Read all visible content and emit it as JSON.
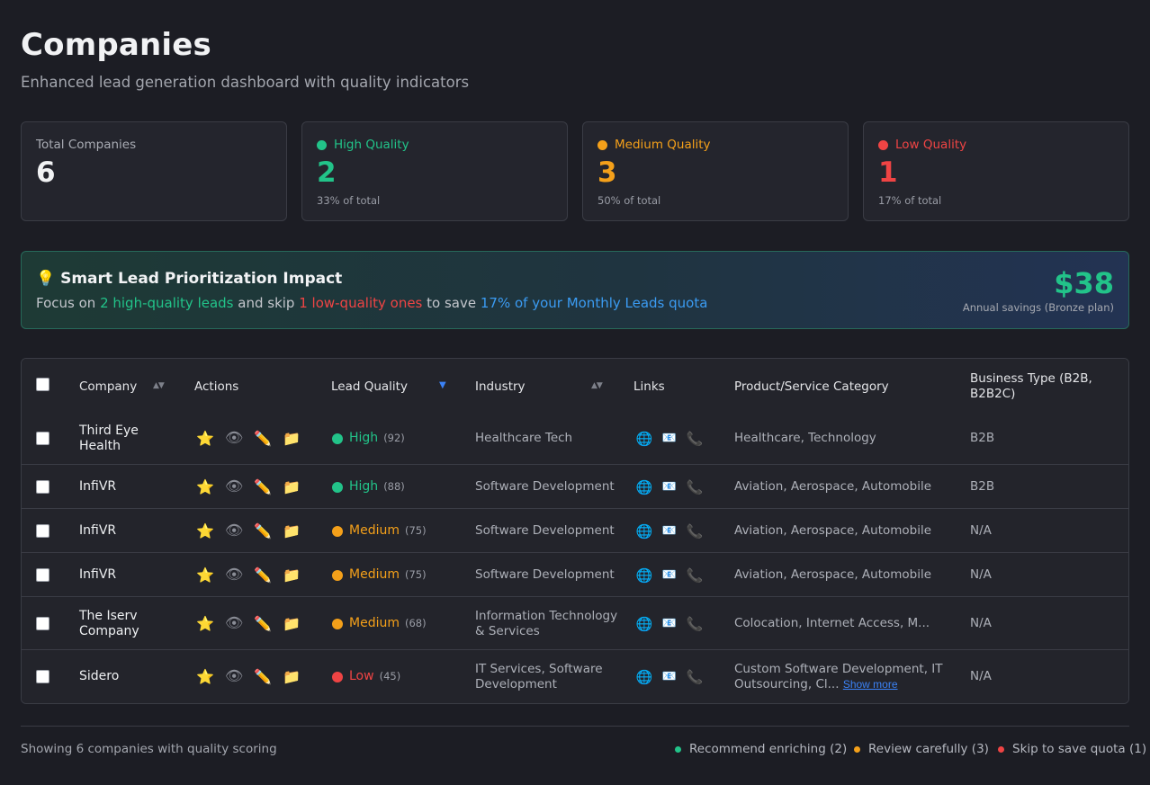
{
  "header": {
    "title": "Companies",
    "subtitle": "Enhanced lead generation dashboard with quality indicators"
  },
  "stats": {
    "total": {
      "label": "Total Companies",
      "value": "6"
    },
    "high": {
      "label": "High Quality",
      "value": "2",
      "sub": "33% of total",
      "color": "#22c389"
    },
    "medium": {
      "label": "Medium Quality",
      "value": "3",
      "sub": "50% of total",
      "color": "#f4a01a"
    },
    "low": {
      "label": "Low Quality",
      "value": "1",
      "sub": "17% of total",
      "color": "#ef4444"
    }
  },
  "banner": {
    "icon": "💡",
    "title": "Smart Lead Prioritization Impact",
    "text_focus": "Focus on ",
    "text_high": "2 high-quality leads",
    "text_skip": " and skip ",
    "text_low": "1 low-quality ones",
    "text_save": " to save ",
    "text_quota": "17% of your Monthly Leads quota",
    "amount": "$38",
    "note": "Annual savings (Bronze plan)"
  },
  "table": {
    "columns": {
      "company": "Company",
      "actions": "Actions",
      "lead_quality": "Lead Quality",
      "industry": "Industry",
      "links": "Links",
      "category": "Product/Service Category",
      "business_type": "Business Type (B2B, B2B2C)"
    },
    "sort_icon": "▲▼",
    "sort_active_icon": "▼",
    "action_icons": {
      "star": "⭐",
      "eye": "👁",
      "edit": "✏️",
      "folder": "📁"
    },
    "link_icons": {
      "web": "🌐",
      "email": "📧",
      "phone": "📞"
    },
    "show_more": "Show more",
    "rows": [
      {
        "company": "Third Eye Health",
        "quality": "High",
        "score": "(92)",
        "industry": "Healthcare Tech",
        "category": "Healthcare, Technology",
        "business_type": "B2B"
      },
      {
        "company": "InfiVR",
        "quality": "High",
        "score": "(88)",
        "industry": "Software Development",
        "category": "Aviation, Aerospace, Automobile",
        "business_type": "B2B"
      },
      {
        "company": "InfiVR",
        "quality": "Medium",
        "score": "(75)",
        "industry": "Software Development",
        "category": "Aviation, Aerospace, Automobile",
        "business_type": "N/A"
      },
      {
        "company": "InfiVR",
        "quality": "Medium",
        "score": "(75)",
        "industry": "Software Development",
        "category": "Aviation, Aerospace, Automobile",
        "business_type": "N/A"
      },
      {
        "company": "The Iserv Company",
        "quality": "Medium",
        "score": "(68)",
        "industry": "Information Technology & Services",
        "category": "Colocation, Internet Access, M...",
        "business_type": "N/A"
      },
      {
        "company": "Sidero",
        "quality": "Low",
        "score": "(45)",
        "industry": "IT Services, Software Development",
        "category": "Custom Software Development, IT Outsourcing, Cl...",
        "business_type": "N/A"
      }
    ]
  },
  "footer": {
    "summary": "Showing 6 companies with quality scoring",
    "legend_enrich": "Recommend enriching (2)",
    "legend_review": "Review carefully (3)",
    "legend_skip": "Skip to save quota (1)"
  }
}
